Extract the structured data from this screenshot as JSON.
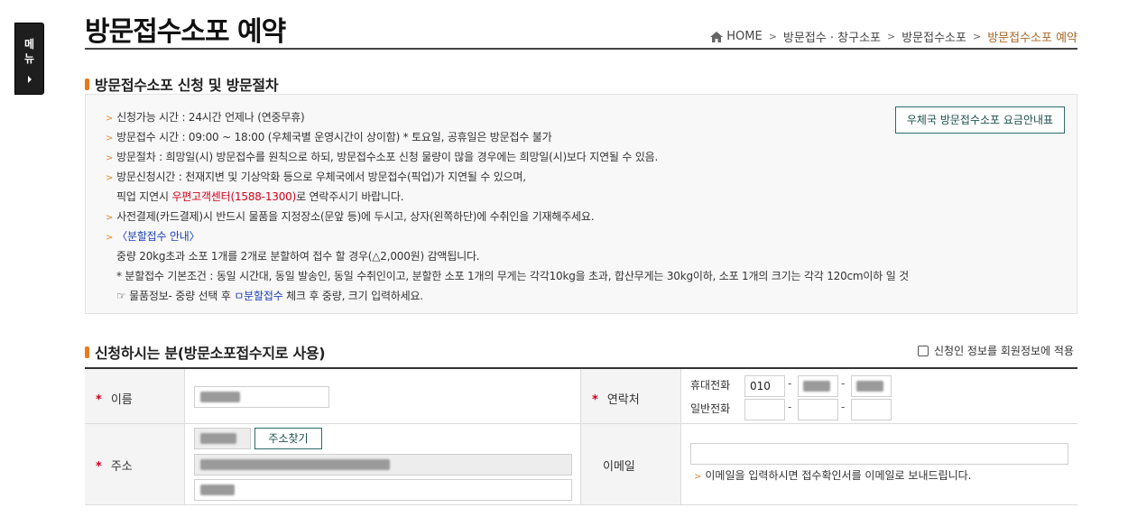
{
  "side_menu": {
    "label_1": "메",
    "label_2": "뉴"
  },
  "page_title": "방문접수소포 예약",
  "breadcrumb": [
    "HOME",
    "방문접수 · 창구소포",
    "방문접수소포",
    "방문접수소포 예약"
  ],
  "section1": {
    "title": "방문접수소포 신청 및 방문절차",
    "rate_button": "우체국 방문접수소포 요금안내표",
    "lines": [
      "신청가능 시간 : 24시간 언제나 (연중무휴)",
      "방문접수 시간 : 09:00 ~ 18:00 (우체국별 운영시간이 상이함) * 토요일, 공휴일은 방문접수 불가",
      "방문절차 : 희망일(시) 방문접수를 원칙으로 하되, 방문접수소포 신청 물량이 많을 경우에는 희망일(시)보다 지연될 수 있음.",
      "방문신청시간 : 천재지변 및 기상악화 등으로 우체국에서 방문접수(픽업)가 지연될 수 있으며,",
      "사전결제(카드결제)시 반드시 물품을 지정장소(문앞 등)에 두시고, 상자(왼쪽하단)에 수취인을 기재해주세요.",
      "중량 20kg초과 소포 1개를 2개로 분할하여 접수 할 경우(△2,000원) 감액됩니다.",
      "* 분할접수 기본조건 : 동일 시간대, 동일 발송인, 동일 수취인이고, 분할한 소포 1개의 무게는 각각10kg을 초과, 합산무게는 30kg이하, 소포 1개의 크기는 각각 120cm이하 일 것"
    ],
    "pickup_prefix": "픽업 지연시 ",
    "pickup_red": "우편고객센터(1588-1300)",
    "pickup_suffix": "로 연락주시기 바랍니다.",
    "split_link": "〈분할접수 안내〉",
    "goods_prefix": "☞ 물품정보- 중량 선택 후 ",
    "goods_blue": "ㅁ분할접수",
    "goods_suffix": " 체크 후 중량, 크기 입력하세요."
  },
  "section2": {
    "title": "신청하시는 분(방문소포접수지로 사용)",
    "apply_checkbox": "신청인 정보를 회원정보에 적용",
    "name_label": "이름",
    "contact_label": "연락처",
    "mobile_label": "휴대전화",
    "mobile_first": "010",
    "phone_label": "일반전화",
    "address_label": "주소",
    "address_button": "주소찾기",
    "email_label": "이메일",
    "email_note": "이메일을 입력하시면 접수확인서를 이메일로 보내드립니다.",
    "required_mark": "*"
  },
  "colors": {
    "accent": "#e87a1e",
    "required": "#d3001a",
    "breadcrumb_current": "#a8672a",
    "button_border": "#2f6a6a"
  }
}
